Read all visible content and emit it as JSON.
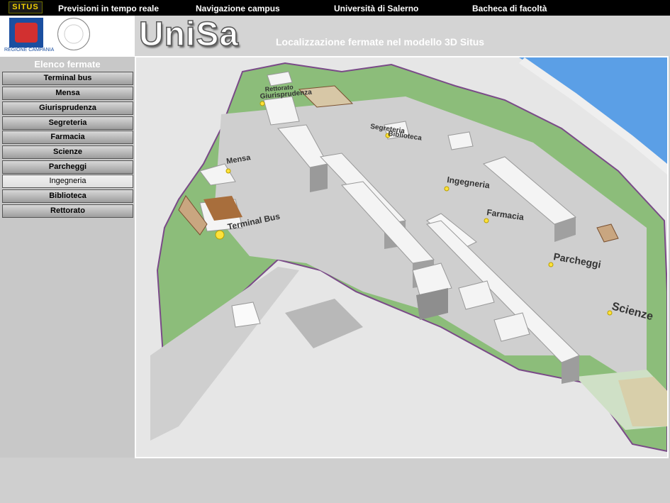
{
  "nav": {
    "logo": "SITUS",
    "items": [
      "Previsioni in tempo reale",
      "Navigazione campus",
      "Università di Salerno",
      "Bacheca di facoltà"
    ]
  },
  "header": {
    "title": "UniSa",
    "subtitle": "Localizzazione fermate nel modello 3D Situs",
    "emblem_caption": "REGIONE CAMPANIA"
  },
  "sidebar": {
    "title": "Elenco fermate",
    "stops": [
      "Terminal bus",
      "Mensa",
      "Giurisprudenza",
      "Segreteria",
      "Farmacia",
      "Scienze",
      "Parcheggi",
      "Ingegneria",
      "Biblioteca",
      "Rettorato"
    ],
    "active_index": 7
  },
  "map": {
    "labels": {
      "rettorato": "Rettorato",
      "giurisprudenza": "Giurisprudenza",
      "segreteria": "Segreteria",
      "biblioteca": "Biblioteca",
      "mensa": "Mensa",
      "ingegneria": "Ingegneria",
      "farmacia": "Farmacia",
      "terminal": "Terminal Bus",
      "parcheggi": "Parcheggi",
      "scienze": "Scienze"
    }
  },
  "colors": {
    "grass": "#8cbd7a",
    "sea": "#5b9fe6",
    "pin": "#ffe23a",
    "accent": "#f3d100"
  }
}
